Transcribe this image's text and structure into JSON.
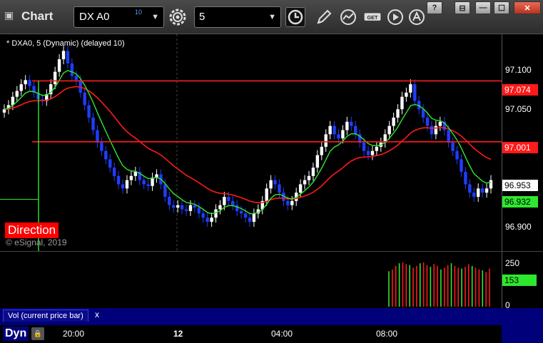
{
  "window": {
    "icon": "window-icon",
    "title": "Chart",
    "symbol": "DX A0",
    "symbol_superscript": "10",
    "interval": "5",
    "buttons": {
      "help": "?",
      "pin": "⊟",
      "minimize": "—",
      "maximize": "☐",
      "close": "✕"
    },
    "toolbar_icons": [
      "gear-icon",
      "clock-icon",
      "pencil-icon",
      "study-icon",
      "get-icon",
      "play-icon",
      "a-icon"
    ],
    "get_label": "GET"
  },
  "chart": {
    "series_label": "* DXA0, 5 (Dynamic) (delayed 10)",
    "copyright": "© eSignal, 2019",
    "direction_label": "Direction",
    "price_ticks": [
      "97.100",
      "97.050",
      "97.001",
      "96.900"
    ],
    "price_tags": {
      "upper_line": "97.074",
      "lower_line": "97.001",
      "last_price": "96.953",
      "green_ma": "96.932"
    },
    "colors": {
      "up_bar": "#ffffff",
      "down_bar": "#1f3dff",
      "red_line": "#ff1a1a",
      "green_line": "#2ee82e",
      "background": "#000000"
    },
    "volume": {
      "ticks": [
        "250",
        "0"
      ],
      "current_tag": "153",
      "tab_label": "Vol (current price bar)",
      "tab_close": "x"
    },
    "time_axis": {
      "mode_label": "Dyn",
      "ticks": [
        "20:00",
        "12",
        "04:00",
        "08:00"
      ]
    }
  },
  "chart_data": {
    "type": "candlestick",
    "ylim": [
      96.87,
      97.13
    ],
    "levels": [
      97.074,
      97.001
    ],
    "last_price": 96.953,
    "green_ma_last": 96.932,
    "close_series": [
      97.04,
      97.045,
      97.055,
      97.062,
      97.07,
      97.075,
      97.068,
      97.06,
      97.052,
      97.05,
      97.058,
      97.07,
      97.085,
      97.1,
      97.11,
      97.095,
      97.08,
      97.075,
      97.06,
      97.045,
      97.03,
      97.015,
      97.0,
      96.99,
      96.98,
      96.97,
      96.96,
      96.95,
      96.945,
      96.955,
      96.96,
      96.965,
      96.955,
      96.95,
      96.948,
      96.958,
      96.962,
      96.95,
      96.935,
      96.925,
      96.922,
      96.925,
      96.92,
      96.918,
      96.925,
      96.922,
      96.915,
      96.91,
      96.905,
      96.91,
      96.92,
      96.925,
      96.935,
      96.93,
      96.925,
      96.918,
      96.915,
      96.91,
      96.905,
      96.915,
      96.92,
      96.93,
      96.945,
      96.955,
      96.95,
      96.94,
      96.93,
      96.925,
      96.93,
      96.94,
      96.95,
      96.955,
      96.96,
      96.97,
      96.985,
      96.995,
      97.01,
      97.02,
      97.01,
      97.005,
      97.015,
      97.025,
      97.02,
      97.01,
      97.0,
      96.99,
      96.985,
      96.99,
      96.995,
      97.0,
      97.01,
      97.02,
      97.03,
      97.04,
      97.055,
      97.06,
      97.07,
      97.05,
      97.04,
      97.03,
      97.02,
      97.01,
      97.02,
      97.025,
      97.015,
      97.0,
      96.99,
      96.98,
      96.965,
      96.95,
      96.94,
      96.935,
      96.945,
      96.94,
      96.945,
      96.955
    ],
    "volume_series": [
      200,
      210,
      230,
      245,
      250,
      240,
      235,
      220,
      230,
      245,
      250,
      235,
      225,
      240,
      230,
      210,
      220,
      235,
      245,
      230,
      220,
      215,
      225,
      240,
      230,
      220,
      210,
      205,
      195,
      215
    ]
  }
}
